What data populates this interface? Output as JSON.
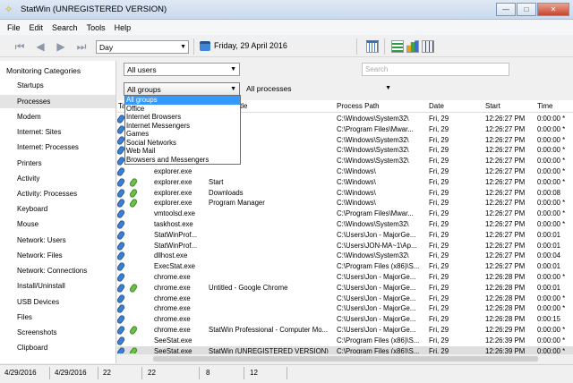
{
  "window": {
    "title": "StatWin (UNREGISTERED VERSION)",
    "minimize": "—",
    "maximize": "□",
    "close": "✕"
  },
  "menu": [
    "File",
    "Edit",
    "Search",
    "Tools",
    "Help"
  ],
  "toolbar": {
    "period": "Day",
    "date": "Friday, 29 April 2016"
  },
  "sidebar": {
    "header": "Monitoring Categories",
    "items": [
      "Startups",
      "Processes",
      "Modem",
      "Internet: Sites",
      "Internet: Processes",
      "Printers",
      "Activity",
      "Activity: Processes",
      "Keyboard",
      "Mouse",
      "Network: Users",
      "Network: Files",
      "Network: Connections",
      "Install/Uninstall",
      "USB Devices",
      "Files",
      "Screenshots",
      "Clipboard"
    ],
    "selected": "Processes"
  },
  "filters": {
    "users": "All users",
    "search_placeholder": "Search",
    "groups": "All groups",
    "processes": "All processes"
  },
  "dropdown": {
    "options": [
      "All groups",
      "Office",
      "Internet Browsers",
      "Internet Messengers",
      "Games",
      "Social Networks",
      "Web Mail",
      "Browsers and Messengers"
    ],
    "selected": "All groups"
  },
  "table": {
    "columns": [
      "Ta",
      "tle",
      "Process Path",
      "Date",
      "Start",
      "Time"
    ],
    "rows": [
      {
        "green": false,
        "exe": "",
        "title": "",
        "path": "C:\\Windows\\System32\\",
        "date": "Fri, 29",
        "start": "12:26:27 PM",
        "time": "0:00:00 *"
      },
      {
        "green": false,
        "exe": "",
        "title": "",
        "path": "C:\\Program Files\\Mwar...",
        "date": "Fri, 29",
        "start": "12:26:27 PM",
        "time": "0:00:00 *"
      },
      {
        "green": false,
        "exe": "",
        "title": "",
        "path": "C:\\Windows\\System32\\",
        "date": "Fri, 29",
        "start": "12:26:27 PM",
        "time": "0:00:00 *"
      },
      {
        "green": false,
        "exe": "",
        "title": "",
        "path": "C:\\Windows\\System32\\",
        "date": "Fri, 29",
        "start": "12:26:27 PM",
        "time": "0:00:00 *"
      },
      {
        "green": false,
        "exe": "",
        "title": "",
        "path": "C:\\Windows\\System32\\",
        "date": "Fri, 29",
        "start": "12:26:27 PM",
        "time": "0:00:00 *"
      },
      {
        "green": false,
        "exe": "explorer.exe",
        "title": "",
        "path": "C:\\Windows\\",
        "date": "Fri, 29",
        "start": "12:26:27 PM",
        "time": "0:00:00 *"
      },
      {
        "green": true,
        "exe": "explorer.exe",
        "title": "Start",
        "path": "C:\\Windows\\",
        "date": "Fri, 29",
        "start": "12:26:27 PM",
        "time": "0:00:00 *"
      },
      {
        "green": true,
        "exe": "explorer.exe",
        "title": "Downloads",
        "path": "C:\\Windows\\",
        "date": "Fri, 29",
        "start": "12:26:27 PM",
        "time": "0:00:08"
      },
      {
        "green": true,
        "exe": "explorer.exe",
        "title": "Program Manager",
        "path": "C:\\Windows\\",
        "date": "Fri, 29",
        "start": "12:26:27 PM",
        "time": "0:00:00 *"
      },
      {
        "green": false,
        "exe": "vmtoolsd.exe",
        "title": "",
        "path": "C:\\Program Files\\Mwar...",
        "date": "Fri, 29",
        "start": "12:26:27 PM",
        "time": "0:00:00 *"
      },
      {
        "green": false,
        "exe": "taskhost.exe",
        "title": "",
        "path": "C:\\Windows\\System32\\",
        "date": "Fri, 29",
        "start": "12:26:27 PM",
        "time": "0:00:00 *"
      },
      {
        "green": false,
        "exe": "StatWinProf...",
        "title": "",
        "path": "C:\\Users\\Jon - MajorGe...",
        "date": "Fri, 29",
        "start": "12:26:27 PM",
        "time": "0:00:01"
      },
      {
        "green": false,
        "exe": "StatWinProf...",
        "title": "",
        "path": "C:\\Users\\JON-MA~1\\Ap...",
        "date": "Fri, 29",
        "start": "12:26:27 PM",
        "time": "0:00:01"
      },
      {
        "green": false,
        "exe": "dllhost.exe",
        "title": "",
        "path": "C:\\Windows\\System32\\",
        "date": "Fri, 29",
        "start": "12:26:27 PM",
        "time": "0:00:04"
      },
      {
        "green": false,
        "exe": "ExecStat.exe",
        "title": "",
        "path": "C:\\Program Files (x86)\\S...",
        "date": "Fri, 29",
        "start": "12:26:27 PM",
        "time": "0:00:01"
      },
      {
        "green": false,
        "exe": "chrome.exe",
        "title": "",
        "path": "C:\\Users\\Jon - MajorGe...",
        "date": "Fri, 29",
        "start": "12:26:28 PM",
        "time": "0:00:00 *"
      },
      {
        "green": true,
        "exe": "chrome.exe",
        "title": "Untitled - Google Chrome",
        "path": "C:\\Users\\Jon - MajorGe...",
        "date": "Fri, 29",
        "start": "12:26:28 PM",
        "time": "0:00:01"
      },
      {
        "green": false,
        "exe": "chrome.exe",
        "title": "",
        "path": "C:\\Users\\Jon - MajorGe...",
        "date": "Fri, 29",
        "start": "12:26:28 PM",
        "time": "0:00:00 *"
      },
      {
        "green": false,
        "exe": "chrome.exe",
        "title": "",
        "path": "C:\\Users\\Jon - MajorGe...",
        "date": "Fri, 29",
        "start": "12:26:28 PM",
        "time": "0:00:00 *"
      },
      {
        "green": false,
        "exe": "chrome.exe",
        "title": "",
        "path": "C:\\Users\\Jon - MajorGe...",
        "date": "Fri, 29",
        "start": "12:26:28 PM",
        "time": "0:00:15"
      },
      {
        "green": true,
        "exe": "chrome.exe",
        "title": "StatWin Professional - Computer Mo...",
        "path": "C:\\Users\\Jon - MajorGe...",
        "date": "Fri, 29",
        "start": "12:26:29 PM",
        "time": "0:00:00 *"
      },
      {
        "green": false,
        "exe": "SeeStat.exe",
        "title": "",
        "path": "C:\\Program Files (x86)\\S...",
        "date": "Fri, 29",
        "start": "12:26:39 PM",
        "time": "0:00:00 *"
      },
      {
        "green": true,
        "exe": "SeeStat.exe",
        "title": "StatWin (UNREGISTERED VERSION)",
        "path": "C:\\Program Files (x86)\\S...",
        "date": "Fri, 29",
        "start": "12:26:39 PM",
        "time": "0:00:00 *"
      }
    ]
  },
  "statusbar": [
    "4/29/2016",
    "4/29/2016",
    "22",
    "22",
    "8",
    "12"
  ]
}
